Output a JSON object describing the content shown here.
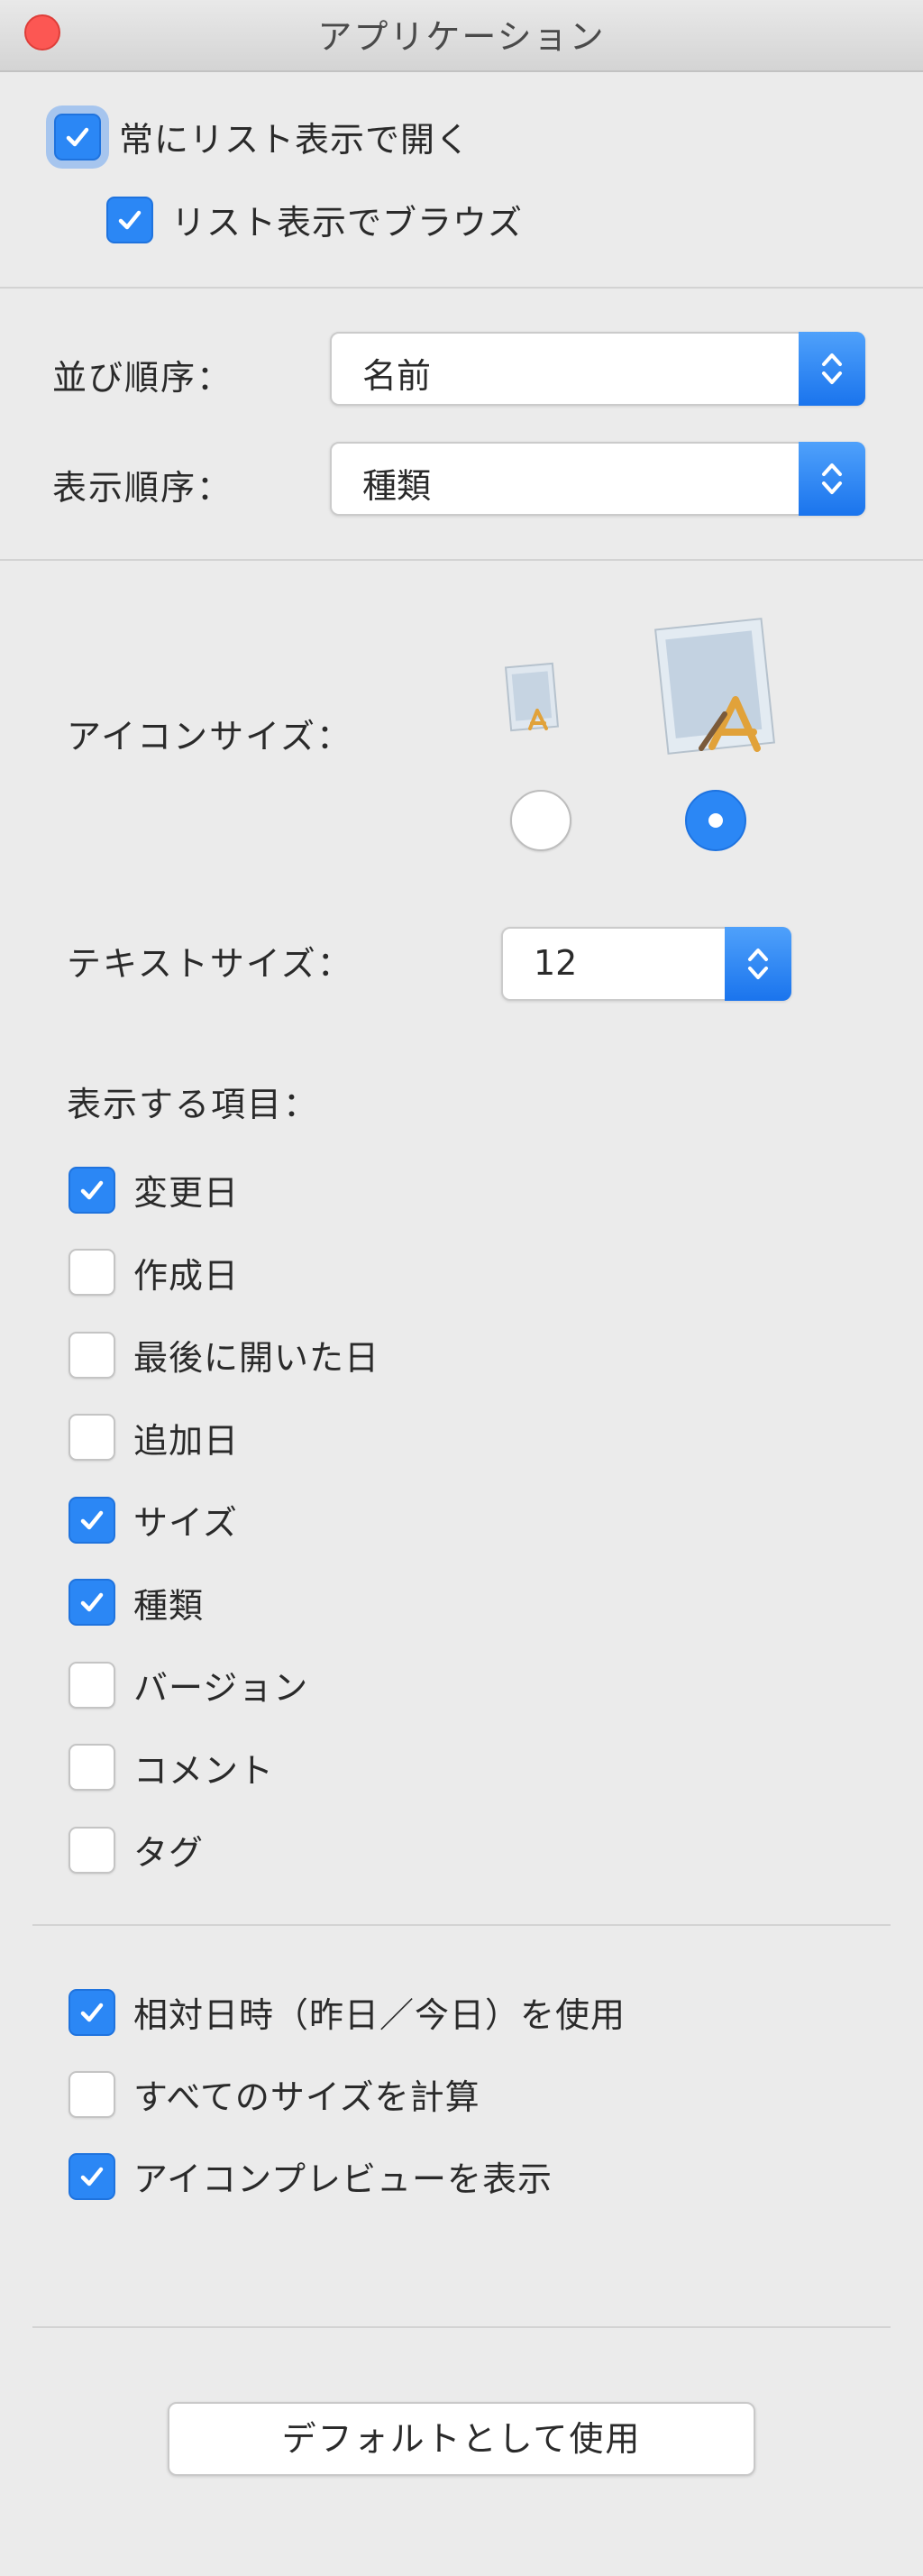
{
  "window": {
    "title": "アプリケーション"
  },
  "options": {
    "always_list": {
      "label": "常にリスト表示で開く",
      "checked": true
    },
    "browse_list": {
      "label": "リスト表示でブラウズ",
      "checked": true
    }
  },
  "sort": {
    "sort_by_label": "並び順序：",
    "sort_by_value": "名前",
    "display_order_label": "表示順序：",
    "display_order_value": "種類"
  },
  "icon_size": {
    "label": "アイコンサイズ：",
    "selected": "large"
  },
  "text_size": {
    "label": "テキストサイズ：",
    "value": "12"
  },
  "columns": {
    "header": "表示する項目：",
    "items": [
      {
        "label": "変更日",
        "checked": true
      },
      {
        "label": "作成日",
        "checked": false
      },
      {
        "label": "最後に開いた日",
        "checked": false
      },
      {
        "label": "追加日",
        "checked": false
      },
      {
        "label": "サイズ",
        "checked": true
      },
      {
        "label": "種類",
        "checked": true
      },
      {
        "label": "バージョン",
        "checked": false
      },
      {
        "label": "コメント",
        "checked": false
      },
      {
        "label": "タグ",
        "checked": false
      }
    ]
  },
  "extra": {
    "items": [
      {
        "label": "相対日時（昨日／今日）を使用",
        "checked": true
      },
      {
        "label": "すべてのサイズを計算",
        "checked": false
      },
      {
        "label": "アイコンプレビューを表示",
        "checked": true
      }
    ]
  },
  "default_button": {
    "label": "デフォルトとして使用"
  },
  "colors": {
    "accent": "#2b87f5",
    "close": "#fc5753",
    "background": "#ebebeb"
  }
}
